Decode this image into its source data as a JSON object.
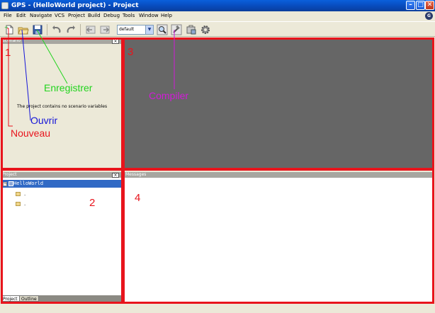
{
  "window": {
    "title": "GPS - (HelloWorld project) - Project",
    "badge": "G"
  },
  "menu": [
    "File",
    "Edit",
    "Navigate",
    "VCS",
    "Project",
    "Build",
    "Debug",
    "Tools",
    "Window",
    "Help"
  ],
  "toolbar": {
    "build_mode": "default"
  },
  "scenario": {
    "title": "Scenario",
    "message": "The project contains no scenario variables"
  },
  "project": {
    "title": "Project",
    "root": "HelloWorld",
    "children": [
      ".",
      "."
    ],
    "tabs": [
      "Project",
      "Outline"
    ]
  },
  "messages": {
    "title": "Messages"
  },
  "annotations": {
    "regions": [
      "1",
      "2",
      "3",
      "4"
    ],
    "labels": {
      "new": "Nouveau",
      "open": "Ouvrir",
      "save": "Enregistrer",
      "compile": "Compiler"
    },
    "colors": {
      "frame": "#E8141C",
      "new": "#E8141C",
      "open": "#1515D8",
      "save": "#22D41E",
      "compile": "#D21BD8"
    }
  }
}
